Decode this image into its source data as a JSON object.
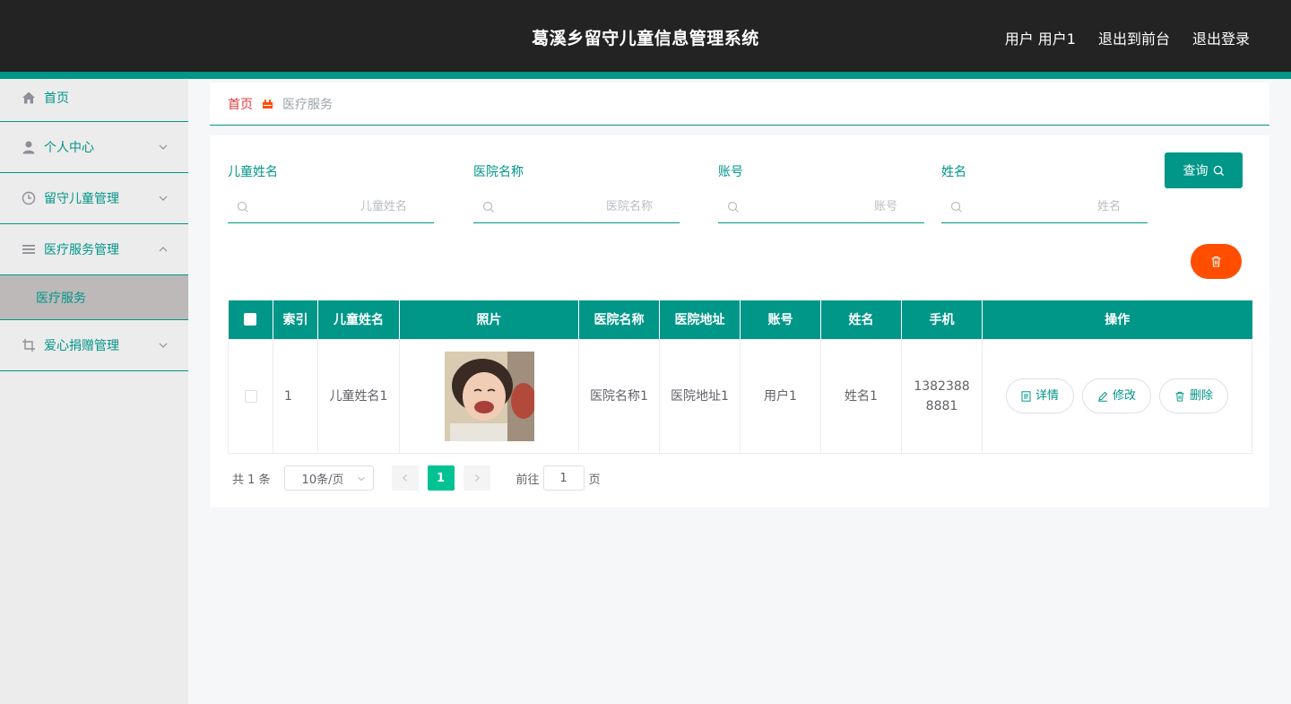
{
  "header": {
    "title": "葛溪乡留守儿童信息管理系统",
    "user_label": "用户 用户1",
    "front_link": "退出到前台",
    "logout_link": "退出登录"
  },
  "sidebar": {
    "items": [
      {
        "label": "首页",
        "icon": "home-icon"
      },
      {
        "label": "个人中心",
        "icon": "user-icon"
      },
      {
        "label": "留守儿童管理",
        "icon": "clock-icon"
      },
      {
        "label": "医疗服务管理",
        "icon": "list-icon"
      },
      {
        "label": "爱心捐赠管理",
        "icon": "crop-icon"
      }
    ],
    "active_sub": "医疗服务"
  },
  "breadcrumb": {
    "home": "首页",
    "current": "医疗服务"
  },
  "filters": [
    {
      "label": "儿童姓名",
      "placeholder": "儿童姓名"
    },
    {
      "label": "医院名称",
      "placeholder": "医院名称"
    },
    {
      "label": "账号",
      "placeholder": "账号"
    },
    {
      "label": "姓名",
      "placeholder": "姓名"
    }
  ],
  "search_button": "查询",
  "colors": {
    "primary": "#009688",
    "danger": "#ff4e00",
    "page_active": "#00c292",
    "header_bg": "#232323"
  },
  "table": {
    "columns": [
      "索引",
      "儿童姓名",
      "照片",
      "医院名称",
      "医院地址",
      "账号",
      "姓名",
      "手机",
      "操作"
    ],
    "rows": [
      {
        "index": "1",
        "child_name": "儿童姓名1",
        "hospital_name": "医院名称1",
        "hospital_address": "医院地址1",
        "account": "用户1",
        "name": "姓名1",
        "phone": "13823888881"
      }
    ],
    "actions": {
      "detail": "详情",
      "edit": "修改",
      "delete": "删除"
    }
  },
  "pagination": {
    "total": "共 1 条",
    "page_size": "10条/页",
    "current_page": "1",
    "goto_label": "前往",
    "goto_value": "1",
    "page_unit": "页"
  }
}
